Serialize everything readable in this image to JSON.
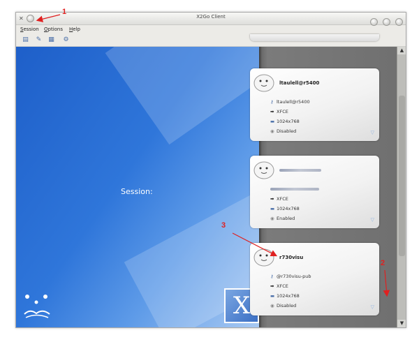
{
  "window": {
    "title": "X2Go Client"
  },
  "menu": [
    {
      "mnemonic": "S",
      "rest": "ession"
    },
    {
      "mnemonic": "O",
      "rest": "ptions"
    },
    {
      "mnemonic": "H",
      "rest": "elp"
    }
  ],
  "desktop": {
    "session_label": "Session:",
    "logo_letter": "X"
  },
  "sessions": [
    {
      "name": "ltaulell@r5400",
      "login": "ltaulell@r5400",
      "desktop": "XFCE",
      "resolution": "1024x768",
      "sound": "Disabled"
    },
    {
      "name": "",
      "login": "",
      "desktop": "XFCE",
      "resolution": "1024x768",
      "sound": "Enabled"
    },
    {
      "name": "r730visu",
      "login": "@r730visu-pub",
      "desktop": "XFCE",
      "resolution": "1024x768",
      "sound": "Disabled"
    }
  ],
  "annotations": [
    "1",
    "2",
    "3"
  ],
  "colors": {
    "annotation": "#e02020",
    "desktop_blue": "#2f76da",
    "panel_gray": "#6f6f6f"
  },
  "icons": [
    "x2go-app-icon",
    "new-session-icon",
    "edit-session-icon",
    "delete-session-icon",
    "settings-icon",
    "key-icon",
    "desktop-arrow-icon",
    "display-icon",
    "sound-icon",
    "expand-chevron-icon"
  ]
}
